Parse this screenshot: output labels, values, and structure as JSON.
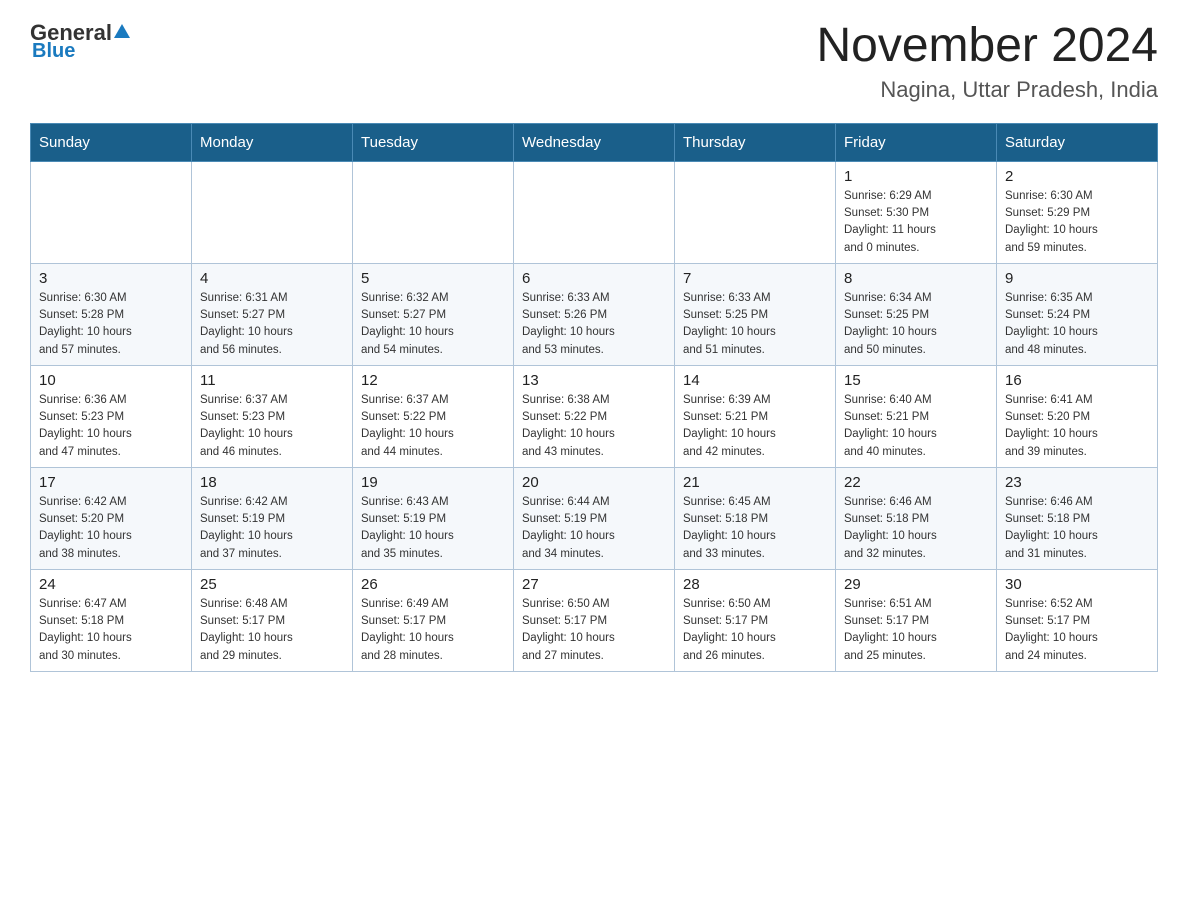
{
  "logo": {
    "text_general": "General",
    "text_blue": "Blue"
  },
  "title": "November 2024",
  "subtitle": "Nagina, Uttar Pradesh, India",
  "days_of_week": [
    "Sunday",
    "Monday",
    "Tuesday",
    "Wednesday",
    "Thursday",
    "Friday",
    "Saturday"
  ],
  "weeks": [
    [
      {
        "day": "",
        "info": ""
      },
      {
        "day": "",
        "info": ""
      },
      {
        "day": "",
        "info": ""
      },
      {
        "day": "",
        "info": ""
      },
      {
        "day": "",
        "info": ""
      },
      {
        "day": "1",
        "info": "Sunrise: 6:29 AM\nSunset: 5:30 PM\nDaylight: 11 hours\nand 0 minutes."
      },
      {
        "day": "2",
        "info": "Sunrise: 6:30 AM\nSunset: 5:29 PM\nDaylight: 10 hours\nand 59 minutes."
      }
    ],
    [
      {
        "day": "3",
        "info": "Sunrise: 6:30 AM\nSunset: 5:28 PM\nDaylight: 10 hours\nand 57 minutes."
      },
      {
        "day": "4",
        "info": "Sunrise: 6:31 AM\nSunset: 5:27 PM\nDaylight: 10 hours\nand 56 minutes."
      },
      {
        "day": "5",
        "info": "Sunrise: 6:32 AM\nSunset: 5:27 PM\nDaylight: 10 hours\nand 54 minutes."
      },
      {
        "day": "6",
        "info": "Sunrise: 6:33 AM\nSunset: 5:26 PM\nDaylight: 10 hours\nand 53 minutes."
      },
      {
        "day": "7",
        "info": "Sunrise: 6:33 AM\nSunset: 5:25 PM\nDaylight: 10 hours\nand 51 minutes."
      },
      {
        "day": "8",
        "info": "Sunrise: 6:34 AM\nSunset: 5:25 PM\nDaylight: 10 hours\nand 50 minutes."
      },
      {
        "day": "9",
        "info": "Sunrise: 6:35 AM\nSunset: 5:24 PM\nDaylight: 10 hours\nand 48 minutes."
      }
    ],
    [
      {
        "day": "10",
        "info": "Sunrise: 6:36 AM\nSunset: 5:23 PM\nDaylight: 10 hours\nand 47 minutes."
      },
      {
        "day": "11",
        "info": "Sunrise: 6:37 AM\nSunset: 5:23 PM\nDaylight: 10 hours\nand 46 minutes."
      },
      {
        "day": "12",
        "info": "Sunrise: 6:37 AM\nSunset: 5:22 PM\nDaylight: 10 hours\nand 44 minutes."
      },
      {
        "day": "13",
        "info": "Sunrise: 6:38 AM\nSunset: 5:22 PM\nDaylight: 10 hours\nand 43 minutes."
      },
      {
        "day": "14",
        "info": "Sunrise: 6:39 AM\nSunset: 5:21 PM\nDaylight: 10 hours\nand 42 minutes."
      },
      {
        "day": "15",
        "info": "Sunrise: 6:40 AM\nSunset: 5:21 PM\nDaylight: 10 hours\nand 40 minutes."
      },
      {
        "day": "16",
        "info": "Sunrise: 6:41 AM\nSunset: 5:20 PM\nDaylight: 10 hours\nand 39 minutes."
      }
    ],
    [
      {
        "day": "17",
        "info": "Sunrise: 6:42 AM\nSunset: 5:20 PM\nDaylight: 10 hours\nand 38 minutes."
      },
      {
        "day": "18",
        "info": "Sunrise: 6:42 AM\nSunset: 5:19 PM\nDaylight: 10 hours\nand 37 minutes."
      },
      {
        "day": "19",
        "info": "Sunrise: 6:43 AM\nSunset: 5:19 PM\nDaylight: 10 hours\nand 35 minutes."
      },
      {
        "day": "20",
        "info": "Sunrise: 6:44 AM\nSunset: 5:19 PM\nDaylight: 10 hours\nand 34 minutes."
      },
      {
        "day": "21",
        "info": "Sunrise: 6:45 AM\nSunset: 5:18 PM\nDaylight: 10 hours\nand 33 minutes."
      },
      {
        "day": "22",
        "info": "Sunrise: 6:46 AM\nSunset: 5:18 PM\nDaylight: 10 hours\nand 32 minutes."
      },
      {
        "day": "23",
        "info": "Sunrise: 6:46 AM\nSunset: 5:18 PM\nDaylight: 10 hours\nand 31 minutes."
      }
    ],
    [
      {
        "day": "24",
        "info": "Sunrise: 6:47 AM\nSunset: 5:18 PM\nDaylight: 10 hours\nand 30 minutes."
      },
      {
        "day": "25",
        "info": "Sunrise: 6:48 AM\nSunset: 5:17 PM\nDaylight: 10 hours\nand 29 minutes."
      },
      {
        "day": "26",
        "info": "Sunrise: 6:49 AM\nSunset: 5:17 PM\nDaylight: 10 hours\nand 28 minutes."
      },
      {
        "day": "27",
        "info": "Sunrise: 6:50 AM\nSunset: 5:17 PM\nDaylight: 10 hours\nand 27 minutes."
      },
      {
        "day": "28",
        "info": "Sunrise: 6:50 AM\nSunset: 5:17 PM\nDaylight: 10 hours\nand 26 minutes."
      },
      {
        "day": "29",
        "info": "Sunrise: 6:51 AM\nSunset: 5:17 PM\nDaylight: 10 hours\nand 25 minutes."
      },
      {
        "day": "30",
        "info": "Sunrise: 6:52 AM\nSunset: 5:17 PM\nDaylight: 10 hours\nand 24 minutes."
      }
    ]
  ]
}
